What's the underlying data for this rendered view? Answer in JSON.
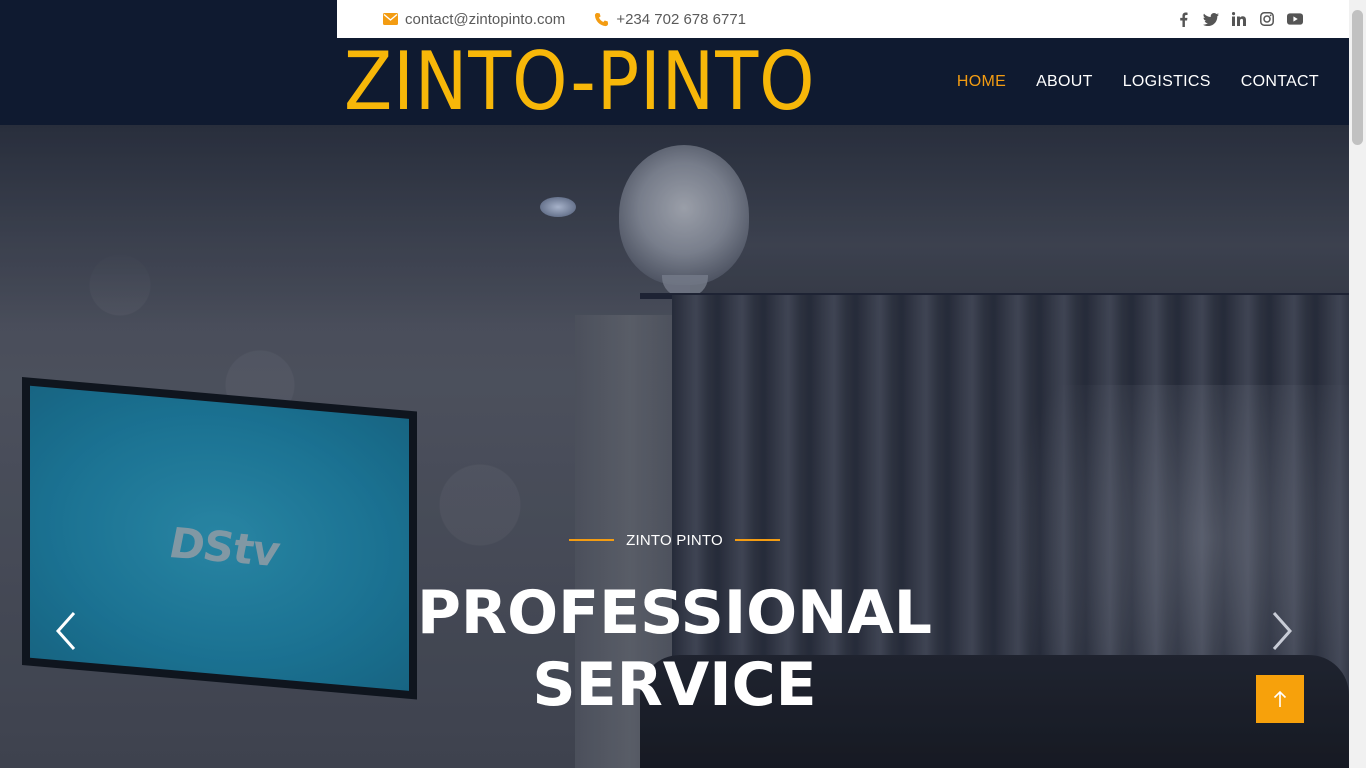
{
  "topbar": {
    "email": "contact@zintopinto.com",
    "phone": "+234 702 678 6771",
    "email_icon": "envelope-icon",
    "phone_icon": "phone-icon",
    "socials": [
      "facebook-icon",
      "twitter-icon",
      "linkedin-icon",
      "instagram-icon",
      "youtube-icon"
    ]
  },
  "header": {
    "logo": "ZINTO-PINTO",
    "nav": [
      {
        "label": "HOME",
        "active": true
      },
      {
        "label": "ABOUT",
        "active": false
      },
      {
        "label": "LOGISTICS",
        "active": false
      },
      {
        "label": "CONTACT",
        "active": false
      }
    ]
  },
  "hero": {
    "subtitle": "ZINTO PINTO",
    "headline_line1": "PROFESSIONAL",
    "headline_line2": "SERVICE",
    "prev_icon": "chevron-left-icon",
    "next_icon": "chevron-right-icon"
  },
  "back_to_top_icon": "arrow-up-icon",
  "colors": {
    "brand_yellow": "#f7b709",
    "accent_orange": "#f39c12",
    "navy": "#0f1a30",
    "button_orange": "#f7a10b"
  }
}
